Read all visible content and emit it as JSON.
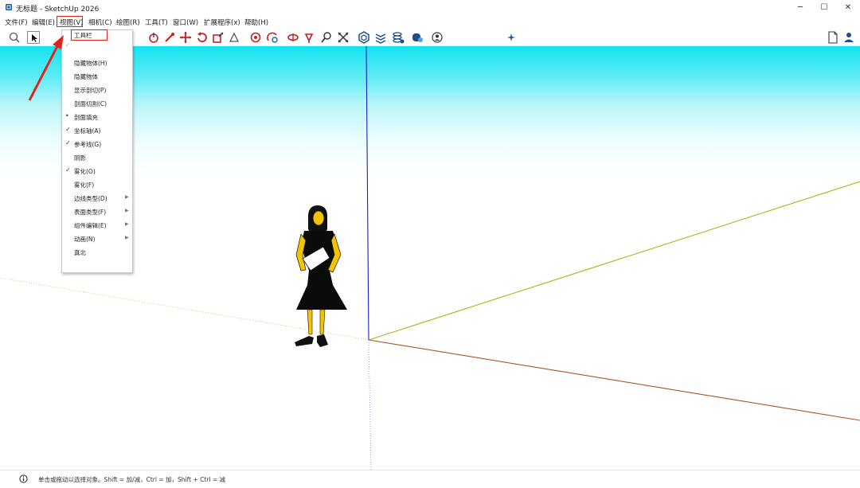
{
  "window": {
    "title": "无标题 - SketchUp 2026",
    "minimize": "─",
    "maximize": "☐",
    "close": "✕"
  },
  "menubar": [
    {
      "label": "文件(F)"
    },
    {
      "label": "编辑(E)"
    },
    {
      "label": "视图(V)"
    },
    {
      "label": "相机(C)"
    },
    {
      "label": "绘图(R)"
    },
    {
      "label": "工具(T)"
    },
    {
      "label": "窗口(W)"
    },
    {
      "label": "扩展程序(x)"
    },
    {
      "label": "帮助(H)"
    }
  ],
  "view_menu": {
    "items": [
      {
        "label": "工具栏",
        "check": "",
        "submenu": false
      },
      {
        "label": "",
        "check": "✓",
        "submenu": false
      },
      {
        "label": "隐藏物体(H)",
        "check": "",
        "submenu": false
      },
      {
        "label": "隐藏物体",
        "check": "",
        "submenu": false
      },
      {
        "label": "显示剖切(P)",
        "check": "",
        "submenu": false
      },
      {
        "label": "剖面切割(C)",
        "check": "",
        "submenu": false
      },
      {
        "label": "剖面填充",
        "check": "•",
        "submenu": false
      },
      {
        "label": "坐标轴(A)",
        "check": "✓",
        "submenu": false
      },
      {
        "label": "参考线(G)",
        "check": "✓",
        "submenu": false
      },
      {
        "label": "阴影",
        "check": "",
        "submenu": false
      },
      {
        "label": "雾化(O)",
        "check": "✓",
        "submenu": false
      },
      {
        "label": "雾化(F)",
        "check": "",
        "submenu": false
      },
      {
        "label": "边线类型(D)",
        "check": "",
        "submenu": true
      },
      {
        "label": "表面类型(F)",
        "check": "",
        "submenu": true
      },
      {
        "label": "组件编辑(E)",
        "check": "",
        "submenu": true
      },
      {
        "label": "动画(N)",
        "check": "",
        "submenu": true
      },
      {
        "label": "真北",
        "check": "",
        "submenu": false
      }
    ]
  },
  "toolbar": {
    "icons": [
      "search-icon",
      "select-arrow-icon",
      "eraser-icon",
      "pencil-icon",
      "push-pull-icon",
      "offset-icon",
      "move-icon",
      "rotate-icon",
      "scale-icon",
      "tape-measure-icon",
      "paint-bucket-icon",
      "orbit-icon",
      "pan-icon",
      "zoom-icon",
      "zoom-extents-icon",
      "components-icon",
      "layers-icon",
      "styles-icon",
      "materials-icon",
      "account-icon",
      "extension-icon",
      "new-document-icon",
      "user-icon"
    ]
  },
  "status": {
    "text": "单击或拖动以选择对象。Shift = 加/减，Ctrl = 加，Shift + Ctrl = 减"
  },
  "colors": {
    "sky_top": "#14e3f1",
    "highlight_red": "#e2231a",
    "green_axis": "#9bbd1a",
    "red_axis": "#a8542a",
    "blue_axis": "#1c1cd0"
  }
}
